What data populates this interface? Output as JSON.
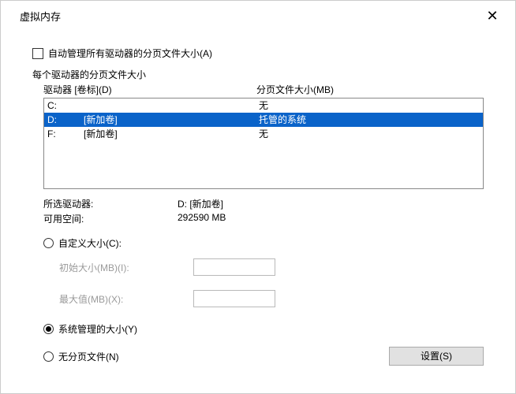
{
  "title": "虚拟内存",
  "auto_manage_label": "自动管理所有驱动器的分页文件大小(A)",
  "section_label": "每个驱动器的分页文件大小",
  "headers": {
    "drive": "驱动器 [卷标](D)",
    "page": "分页文件大小(MB)"
  },
  "drives": [
    {
      "letter": "C:",
      "label": "",
      "page": "无"
    },
    {
      "letter": "D:",
      "label": "[新加卷]",
      "page": "托管的系统"
    },
    {
      "letter": "F:",
      "label": "[新加卷]",
      "page": "无"
    }
  ],
  "info": {
    "selected_label": "所选驱动器:",
    "selected_value": "D:  [新加卷]",
    "avail_label": "可用空间:",
    "avail_value": "292590 MB"
  },
  "radios": {
    "custom": "自定义大小(C):",
    "initial_label": "初始大小(MB)(I):",
    "max_label": "最大值(MB)(X):",
    "system": "系统管理的大小(Y)",
    "none": "无分页文件(N)"
  },
  "set_button": "设置(S)"
}
